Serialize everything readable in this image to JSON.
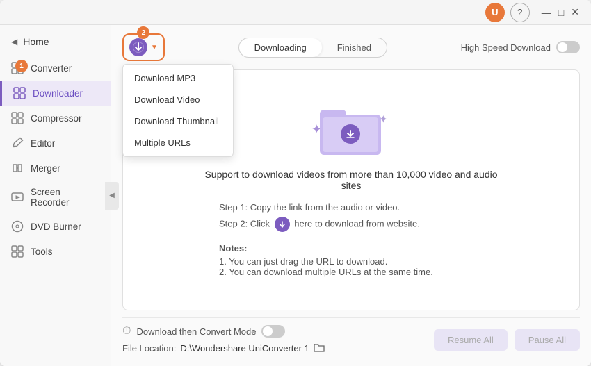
{
  "titlebar": {
    "user_initial": "U",
    "help_label": "?",
    "minimize": "—",
    "maximize": "□",
    "close": "✕"
  },
  "sidebar": {
    "home_label": "Home",
    "items": [
      {
        "id": "converter",
        "label": "Converter",
        "icon": "⬡",
        "active": false,
        "badge": "1"
      },
      {
        "id": "downloader",
        "label": "Downloader",
        "icon": "⬡",
        "active": true,
        "badge": null
      },
      {
        "id": "compressor",
        "label": "Compressor",
        "icon": "⬡",
        "active": false
      },
      {
        "id": "editor",
        "label": "Editor",
        "icon": "⬡",
        "active": false
      },
      {
        "id": "merger",
        "label": "Merger",
        "icon": "⬡",
        "active": false
      },
      {
        "id": "screen-recorder",
        "label": "Screen Recorder",
        "icon": "⬡",
        "active": false
      },
      {
        "id": "dvd-burner",
        "label": "DVD Burner",
        "icon": "⬡",
        "active": false
      },
      {
        "id": "tools",
        "label": "Tools",
        "icon": "⬡",
        "active": false
      }
    ]
  },
  "toolbar": {
    "download_btn_label": "",
    "badge_number": "2",
    "dropdown": {
      "items": [
        "Download MP3",
        "Download Video",
        "Download Thumbnail",
        "Multiple URLs"
      ]
    }
  },
  "tabs": {
    "downloading": "Downloading",
    "finished": "Finished",
    "active": "downloading"
  },
  "speed_toggle": {
    "label": "High Speed Download",
    "enabled": false
  },
  "main_area": {
    "support_text": "Support to download videos from more than 10,000 video and audio\nsites",
    "step1": "Step 1: Copy the link from the audio or video.",
    "step2": "Step 2: Click",
    "step2_suffix": "here to download from website.",
    "notes_title": "Notes:",
    "note1": "1. You can just drag the URL to download.",
    "note2": "2. You can download multiple URLs at the same time."
  },
  "bottom_bar": {
    "convert_mode_label": "Download then Convert Mode",
    "file_location_label": "File Location:",
    "file_path": "D:\\Wondershare UniConverter 1",
    "resume_btn": "Resume All",
    "pause_btn": "Pause All"
  }
}
